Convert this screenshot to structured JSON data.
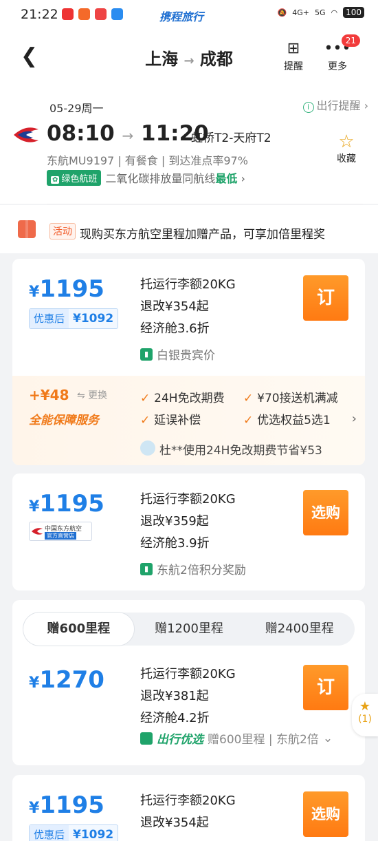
{
  "status": {
    "time": "21:22",
    "brand": "携程旅行",
    "battery": "100",
    "signal1": "4G+",
    "signal2": "5G"
  },
  "header": {
    "from": "上海",
    "to": "成都",
    "remind_label": "提醒",
    "more_label": "更多",
    "more_badge": "21"
  },
  "flight": {
    "date": "05-29周一",
    "travel_remind": "出行提醒",
    "depart": "08:10",
    "arrive": "11:20",
    "airports": "虹桥T2-天府T2",
    "meta": "东航MU9197 | 有餐食 | 到达准点率97%",
    "green_tag": "绿色航班",
    "green_text": "二氧化碳排放量同航线",
    "green_low": "最低",
    "collect_label": "收藏"
  },
  "promo": {
    "tag": "活动",
    "text": "现购买东方航空里程加赠产品，可享加倍里程奖"
  },
  "offers": [
    {
      "price": "1195",
      "currency": "¥",
      "disc_label": "优惠后",
      "disc_value": "¥1092",
      "baggage": "托运行李额20KG",
      "refund": "退改¥354起",
      "cabin": "经济舱3.6折",
      "perk": "白银贵宾价",
      "button": "订",
      "insurance": {
        "price": "+¥48",
        "swap": "⇋ 更换",
        "name": "全能保障服务",
        "items": [
          "24H免改期费",
          "¥70接送机满减",
          "延误补偿",
          "优选权益5选1"
        ],
        "user_note": "杜**使用24H免改期费节省¥53"
      }
    },
    {
      "price": "1195",
      "currency": "¥",
      "store_name": "中国东方航空",
      "store_tag": "官方直营店",
      "baggage": "托运行李额20KG",
      "refund": "退改¥359起",
      "cabin": "经济舱3.9折",
      "perk": "东航2倍积分奖励",
      "button": "选购"
    },
    {
      "tabs": [
        "赠600里程",
        "赠1200里程",
        "赠2400里程"
      ],
      "price": "1270",
      "currency": "¥",
      "baggage": "托运行李额20KG",
      "refund": "退改¥381起",
      "cabin": "经济舱4.2折",
      "perk_brand": "出行优选",
      "perk": "赠600里程 | 东航2倍",
      "button": "订"
    },
    {
      "price": "1195",
      "currency": "¥",
      "disc_label": "优惠后",
      "disc_value": "¥1092",
      "baggage": "托运行李额20KG",
      "refund": "退改¥354起",
      "button": "选购"
    }
  ],
  "float": {
    "count": "(1)"
  }
}
